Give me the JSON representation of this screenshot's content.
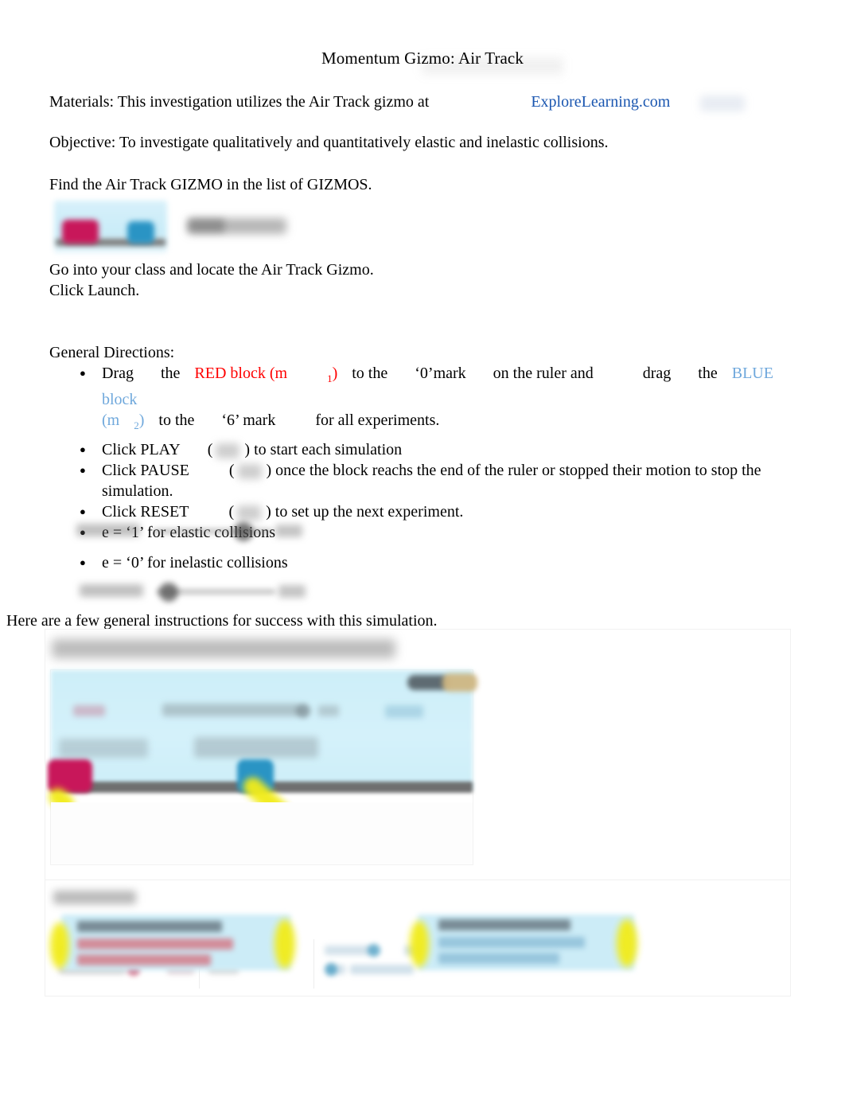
{
  "document": {
    "title": "Momentum Gizmo: Air Track",
    "materials": {
      "prefix": "Materials: This investigation utilizes the Air Track gizmo at",
      "link_text": "ExploreLearning.com",
      "link_color": "#1a56b0"
    },
    "objective": "Objective: To investigate qualitatively and quantitatively elastic and inelastic collisions.",
    "find_gizmo": "Find the Air Track GIZMO in the list of GIZMOS.",
    "gizmo_thumbnail_label": "Air Track",
    "go_to_class": "Go into your class and locate the Air Track Gizmo.",
    "click_launch": "Click Launch.",
    "directions_heading": "General Directions:",
    "instructions_intro": "Here are a few general instructions for success with this simulation."
  },
  "directions": {
    "drag": {
      "w1": "Drag",
      "w2": "the",
      "red_block": "RED block (m",
      "red_sub": "1",
      "red_close": ")",
      "w3": "to the",
      "mark0": "‘0’mark",
      "w4": "on the ruler and",
      "w5": "drag",
      "w6": "the",
      "blue_block": "BLUE block",
      "blue_m": "(m",
      "blue_sub": "2",
      "blue_close": ")",
      "w7": "to the",
      "mark6": "‘6’ mark",
      "w8": "for all experiments.",
      "red_color": "#ff0000",
      "blue_color": "#6fa8dc"
    },
    "play": {
      "label": "Click PLAY",
      "suffix": ") to start each simulation",
      "open": "("
    },
    "pause": {
      "label": "Click PAUSE",
      "suffix": ") once the block reachs the end of the ruler or stopped their motion to stop the",
      "suffix2": "simulation.",
      "open": "("
    },
    "reset": {
      "label": "Click RESET",
      "suffix": ") to set up the next experiment.",
      "open": "("
    },
    "elastic": "e = ‘1’ for elastic collisions",
    "inelastic": "e = ‘0’ for inelastic collisions"
  },
  "screenshot": {
    "heading": "Set the blocks in the proper positions.",
    "callout_heading": "Use proper Numbers",
    "sim": {
      "red_block_color": "#c8175a",
      "blue_block_color": "#2a94c4",
      "track_color": "#6f6f6f",
      "sky_color": "#cdeef8",
      "highlighter_color": "#f2ec19"
    }
  }
}
